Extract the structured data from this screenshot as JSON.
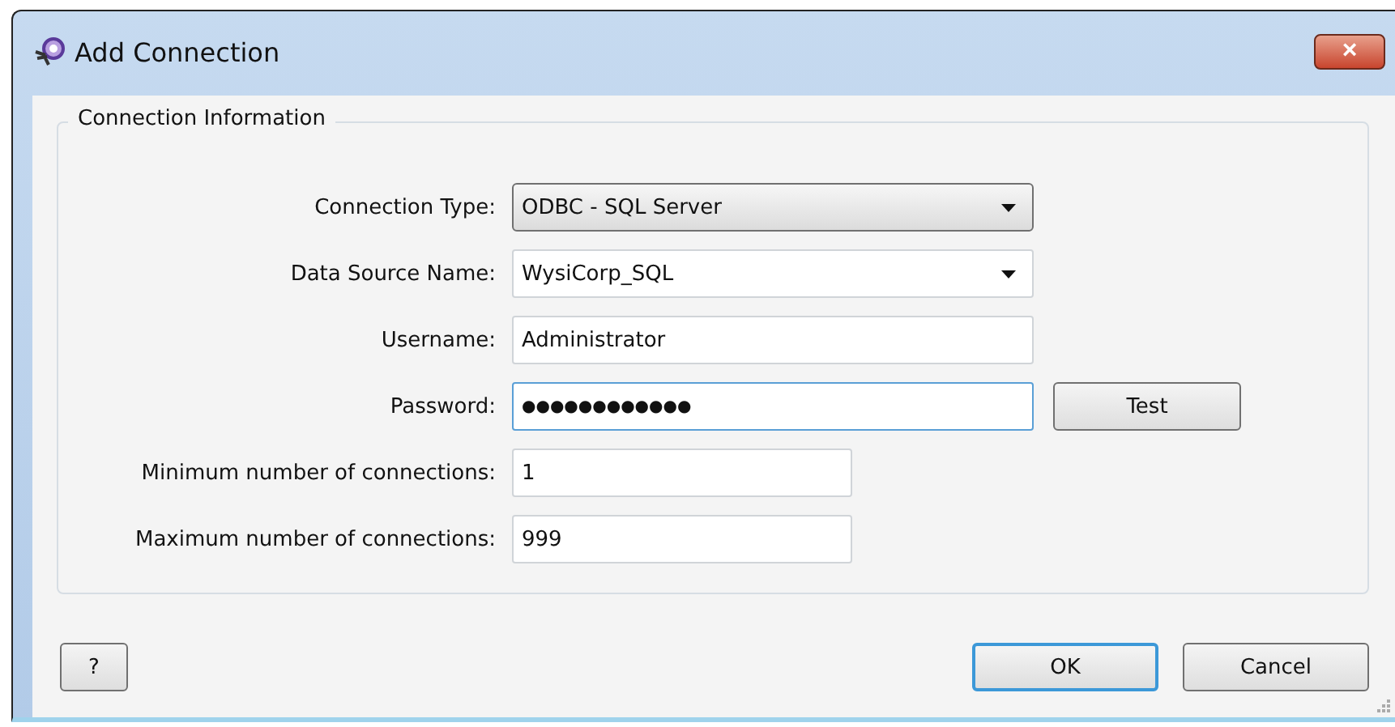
{
  "window": {
    "title": "Add Connection",
    "close": "×"
  },
  "group": {
    "title": "Connection Information"
  },
  "fields": [
    {
      "label": "Connection Type:",
      "kind": "dropdown",
      "value": "ODBC - SQL Server",
      "focused": false
    },
    {
      "label": "Data Source Name:",
      "kind": "combo",
      "value": "WysiCorp_SQL",
      "focused": false
    },
    {
      "label": "Username:",
      "kind": "text",
      "value": "Administrator",
      "focused": false
    },
    {
      "label": "Password:",
      "kind": "password",
      "value": "●●●●●●●●●●●●",
      "focused": true,
      "button": "Test"
    },
    {
      "label": "Minimum number of connections:",
      "kind": "number",
      "value": "1",
      "focused": false
    },
    {
      "label": "Maximum number of connections:",
      "kind": "number",
      "value": "999",
      "focused": false
    }
  ],
  "buttons": [
    {
      "label": "?",
      "default": false,
      "kind": "help"
    },
    {
      "label": "OK",
      "default": true,
      "kind": "action"
    },
    {
      "label": "Cancel",
      "default": false,
      "kind": "action"
    }
  ]
}
